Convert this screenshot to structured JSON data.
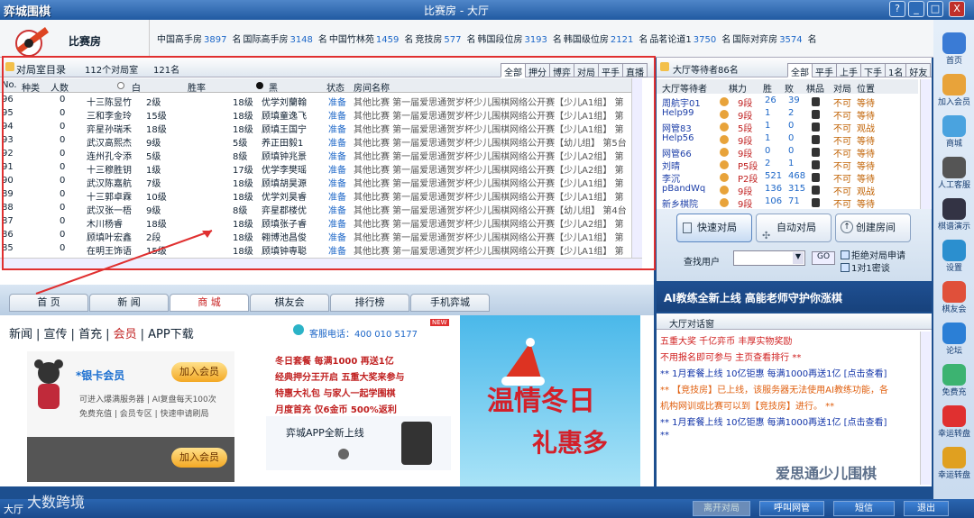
{
  "window": {
    "title": "比赛房 - 大厅",
    "logo": "弈城围棋",
    "controls": [
      "?",
      "_",
      "□",
      "X"
    ]
  },
  "room": {
    "name": "比赛房",
    "rooms": [
      {
        "name": "中国高手房",
        "count": "3897",
        "unit": "名"
      },
      {
        "name": "国际高手房",
        "count": "3148",
        "unit": "名"
      },
      {
        "name": "中国竹林苑",
        "count": "1459",
        "unit": "名"
      },
      {
        "name": "竞技房",
        "count": "577",
        "unit": "名"
      },
      {
        "name": "韩国段位房",
        "count": "3193",
        "unit": "名"
      },
      {
        "name": "韩国级位房",
        "count": "2121",
        "unit": "名"
      },
      {
        "name": "品茗论道1",
        "count": "3750",
        "unit": "名"
      },
      {
        "name": "国际对弈房",
        "count": "3574",
        "unit": "名"
      }
    ]
  },
  "game_list": {
    "title": "对局室目录",
    "room_count": "112个对局室",
    "player_count": "121名",
    "tabs": [
      "全部",
      "押分",
      "博弈",
      "对局",
      "平手",
      "直播"
    ],
    "columns": [
      "No.",
      "种类",
      "人数",
      "白",
      "胜率",
      "黑",
      "状态",
      "房间名称"
    ],
    "rows": [
      {
        "no": "96",
        "kind": "",
        "people": "0",
        "white": "十三陈昱竹",
        "wrank": "2级",
        "brank": "18级",
        "black": "优学刘蘭翰",
        "status": "准备",
        "room": "其他比赛 第一届爱思通贺岁杯少儿围棋网络公开赛【少儿A1组】 第"
      },
      {
        "no": "95",
        "kind": "",
        "people": "0",
        "white": "三和李金玲",
        "wrank": "15级",
        "brank": "18级",
        "black": "顾填童逸飞",
        "status": "准备",
        "room": "其他比赛 第一届爱思通贺岁杯少儿围棋网络公开赛【少儿A1组】 第"
      },
      {
        "no": "94",
        "kind": "",
        "people": "0",
        "white": "弈星孙瑞禾",
        "wrank": "18级",
        "brank": "18级",
        "black": "顾填王国宁",
        "status": "准备",
        "room": "其他比赛 第一届爱思通贺岁杯少儿围棋网络公开赛【少儿A1组】 第"
      },
      {
        "no": "93",
        "kind": "",
        "people": "0",
        "white": "武汉高熙杰",
        "wrank": "9级",
        "brank": "5级",
        "black": "养正田毅1",
        "status": "准备",
        "room": "其他比赛 第一届爱思通贺岁杯少儿围棋网络公开赛【幼儿组】 第5台"
      },
      {
        "no": "92",
        "kind": "",
        "people": "0",
        "white": "连州孔令添",
        "wrank": "5级",
        "brank": "8级",
        "black": "顾填钟兆景",
        "status": "准备",
        "room": "其他比赛 第一届爱思通贺岁杯少儿围棋网络公开赛【少儿A2组】 第"
      },
      {
        "no": "91",
        "kind": "",
        "people": "0",
        "white": "十三穆胜钥",
        "wrank": "1级",
        "brank": "17级",
        "black": "优学李樊瑶",
        "status": "准备",
        "room": "其他比赛 第一届爱思通贺岁杯少儿围棋网络公开赛【少儿A2组】 第"
      },
      {
        "no": "90",
        "kind": "",
        "people": "0",
        "white": "武汉陈嘉航",
        "wrank": "7级",
        "brank": "18级",
        "black": "顾填胡昊源",
        "status": "准备",
        "room": "其他比赛 第一届爱思通贺岁杯少儿围棋网络公开赛【少儿A1组】 第"
      },
      {
        "no": "89",
        "kind": "",
        "people": "0",
        "white": "十三郭卓霖",
        "wrank": "10级",
        "brank": "18级",
        "black": "优学刘昊睿",
        "status": "准备",
        "room": "其他比赛 第一届爱思通贺岁杯少儿围棋网络公开赛【少儿A1组】 第"
      },
      {
        "no": "88",
        "kind": "",
        "people": "0",
        "white": "武汉张一梧",
        "wrank": "9级",
        "brank": "8级",
        "black": "弈星郡楼优",
        "status": "准备",
        "room": "其他比赛 第一届爱思通贺岁杯少儿围棋网络公开赛【幼儿组】 第4台"
      },
      {
        "no": "87",
        "kind": "",
        "people": "0",
        "white": "木川杨睿",
        "wrank": "18级",
        "brank": "18级",
        "black": "顾填张子睿",
        "status": "准备",
        "room": "其他比赛 第一届爱思通贺岁杯少儿围棋网络公开赛【少儿A2组】 第"
      },
      {
        "no": "86",
        "kind": "",
        "people": "0",
        "white": "顾填叶宏鑫",
        "wrank": "2段",
        "brank": "18级",
        "black": "翱博池昌俊",
        "status": "准备",
        "room": "其他比赛 第一届爱思通贺岁杯少儿围棋网络公开赛【少儿A1组】 第"
      },
      {
        "no": "85",
        "kind": "",
        "people": "0",
        "white": "在明王饰语",
        "wrank": "15级",
        "brank": "18级",
        "black": "顾填钟専聪",
        "status": "准备",
        "room": "其他比赛 第一届爱思通贺岁杯少儿围棋网络公开赛【少儿A1组】 第"
      }
    ]
  },
  "waiting": {
    "title": "大厅等待者86名",
    "tabs": [
      "全部",
      "平手",
      "上手",
      "下手",
      "1名",
      "好友"
    ],
    "columns": [
      "大厅等待者",
      "棋力",
      "胜",
      "败",
      "棋品",
      "对局",
      "位置"
    ],
    "rows": [
      {
        "name": "周航宇01",
        "rank": "9段",
        "win": "26",
        "loss": "39",
        "fight": "不可",
        "place": "等待"
      },
      {
        "name": "Help99",
        "rank": "9段",
        "win": "1",
        "loss": "2",
        "fight": "不可",
        "place": "等待"
      },
      {
        "name": "网管83",
        "rank": "5段",
        "win": "1",
        "loss": "0",
        "fight": "不可",
        "place": "观战"
      },
      {
        "name": "Help56",
        "rank": "9段",
        "win": "1",
        "loss": "0",
        "fight": "不可",
        "place": "等待"
      },
      {
        "name": "网管66",
        "rank": "9段",
        "win": "0",
        "loss": "0",
        "fight": "不可",
        "place": "等待"
      },
      {
        "name": "刘晴",
        "rank": "P5段",
        "win": "2",
        "loss": "1",
        "fight": "不可",
        "place": "等待"
      },
      {
        "name": "李沉",
        "rank": "P2段",
        "win": "521",
        "loss": "468",
        "fight": "不可",
        "place": "等待"
      },
      {
        "name": "pBandWq",
        "rank": "9段",
        "win": "136",
        "loss": "315",
        "fight": "不可",
        "place": "观战"
      },
      {
        "name": "新乡棋院",
        "rank": "9段",
        "win": "106",
        "loss": "71",
        "fight": "不可",
        "place": "等待"
      }
    ]
  },
  "actions": {
    "quick": "快速对局",
    "auto": "自动对局",
    "create": "创建房间",
    "search_label": "查找用户",
    "go": "GO",
    "refuse": "拒绝对局申请",
    "onevone": "1对1密谈"
  },
  "ad_banner": "AI教练全新上线 高能老师守护你涨棋",
  "chat": {
    "title": "大厅对话窗",
    "lines": [
      {
        "text": "五重大奖 千亿弈币 丰厚实物奖励",
        "style": "red"
      },
      {
        "text": "不用报名即可参与 主页查看排行 **",
        "style": "red"
      },
      {
        "text": "** 1月套餐上线 10亿钜惠 每满1000再送1亿 [点击查看]",
        "style": "blue"
      },
      {
        "text": "** 【竞技房】已上线，该服务器无法使用AI教练功能，各",
        "style": "orange"
      },
      {
        "text": "机构网训或比赛可以到【竞技房】进行。 **",
        "style": "orange"
      },
      {
        "text": "** 1月套餐上线 10亿钜惠 每满1000再送1亿 [点击查看]",
        "style": "blue"
      },
      {
        "text": "**",
        "style": "blue"
      }
    ]
  },
  "nav_tabs": [
    "首 页",
    "新 闻",
    "商 城",
    "棋友会",
    "排行榜",
    "手机弈城"
  ],
  "promo": {
    "subnav": [
      "新闻",
      "宣传",
      "首充",
      "会员",
      "APP下载"
    ],
    "member_title": "*银卡会员",
    "member_btn": "加入会员",
    "member_desc1": "可进入爆满服务器 | AI复盘每天100次",
    "member_desc2": "免费充值 | 会员专区 | 快速申请刷局",
    "member_btn2": "加入会员",
    "service": "客服电话：400 010 5177",
    "new": "NEW",
    "offers": [
      "冬日套餐 每满1000 再送1亿",
      "经典押分王开启 五重大奖来参与",
      "特惠大礼包 与家人一起学围棋",
      "月度首充 仅6金币 500%返利"
    ],
    "app": "弈城APP全新上线",
    "banner_big": "温情冬日",
    "banner_sub": "礼惠多"
  },
  "sidebar": [
    "首页",
    "加入会员",
    "商城",
    "人工客服",
    "棋谱演示",
    "设置",
    "棋友会",
    "论坛",
    "免费充",
    "幸运转盘",
    "幸运转盘"
  ],
  "bottom": {
    "lobby": "大厅",
    "leave": "离开对局",
    "call": "呼叫网管",
    "sms": "短信",
    "exit": "退出"
  },
  "watermark": {
    "left": "大数跨境",
    "right": "爱思通少儿围棋"
  },
  "colors": {
    "accent": "#1f5aa8",
    "frame": "#e03030",
    "status": "#1d67c8"
  }
}
